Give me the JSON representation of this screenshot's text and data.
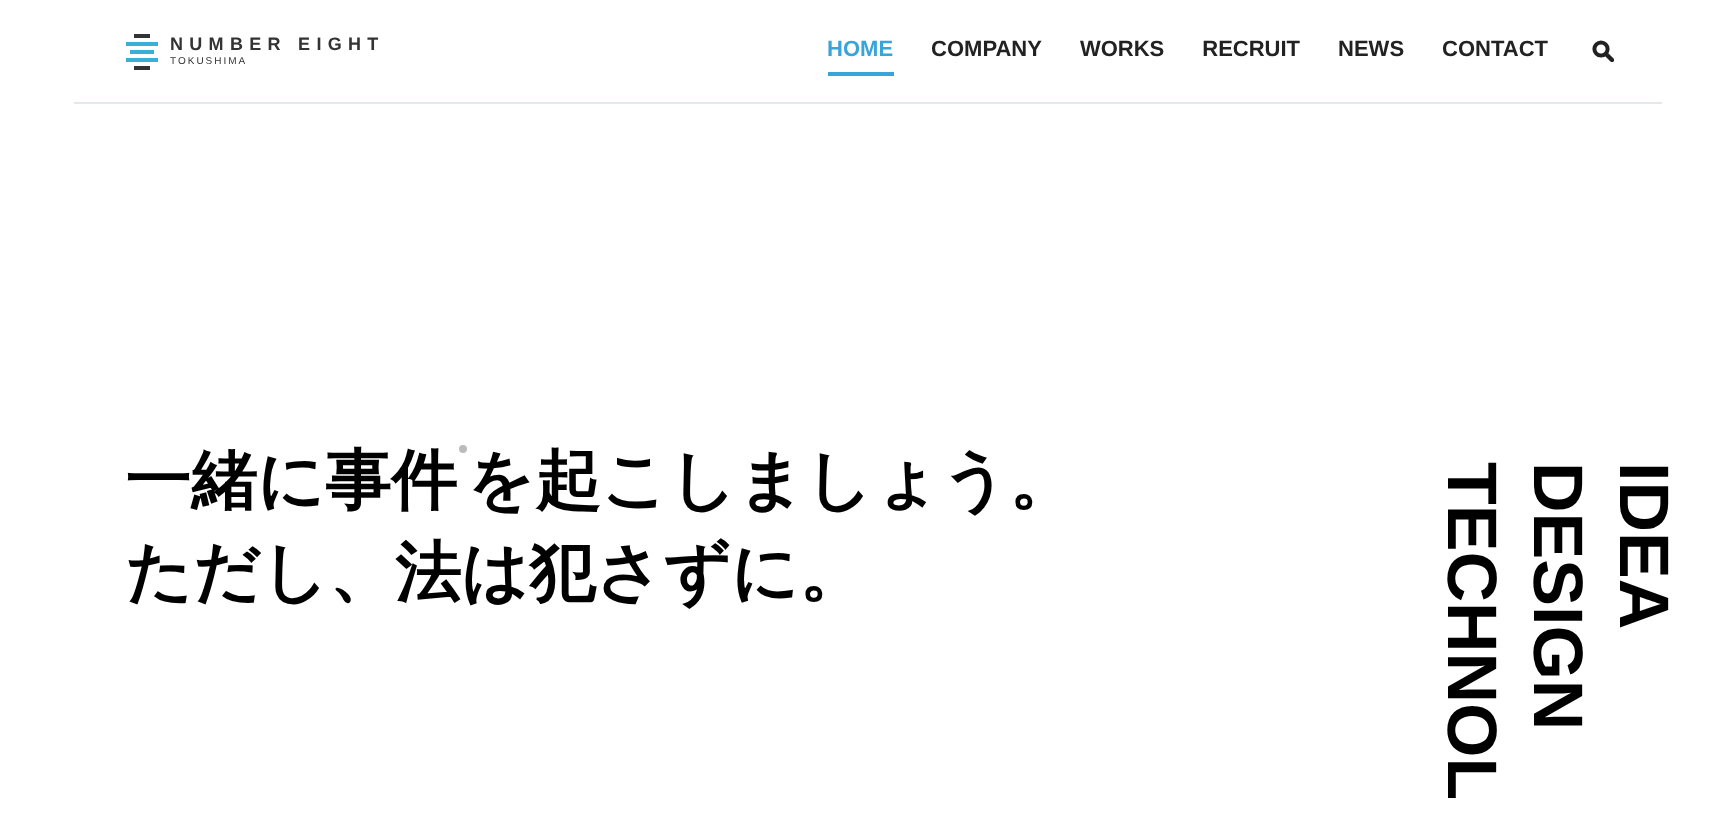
{
  "logo": {
    "name": "NUMBER EIGHT",
    "sub": "TOKUSHIMA"
  },
  "nav": [
    {
      "label": "HOME",
      "selected": true
    },
    {
      "label": "COMPANY",
      "selected": false
    },
    {
      "label": "WORKS",
      "selected": false
    },
    {
      "label": "RECRUIT",
      "selected": false
    },
    {
      "label": "NEWS",
      "selected": false
    },
    {
      "label": "CONTACT",
      "selected": false
    }
  ],
  "headline": {
    "line_1a": "一緒に事件",
    "line_1b": "を起こしましょう。",
    "line_2": "ただし、法は犯さずに。"
  },
  "vertical_words": [
    "IDEA",
    "DESIGN",
    "TECHNOL"
  ]
}
